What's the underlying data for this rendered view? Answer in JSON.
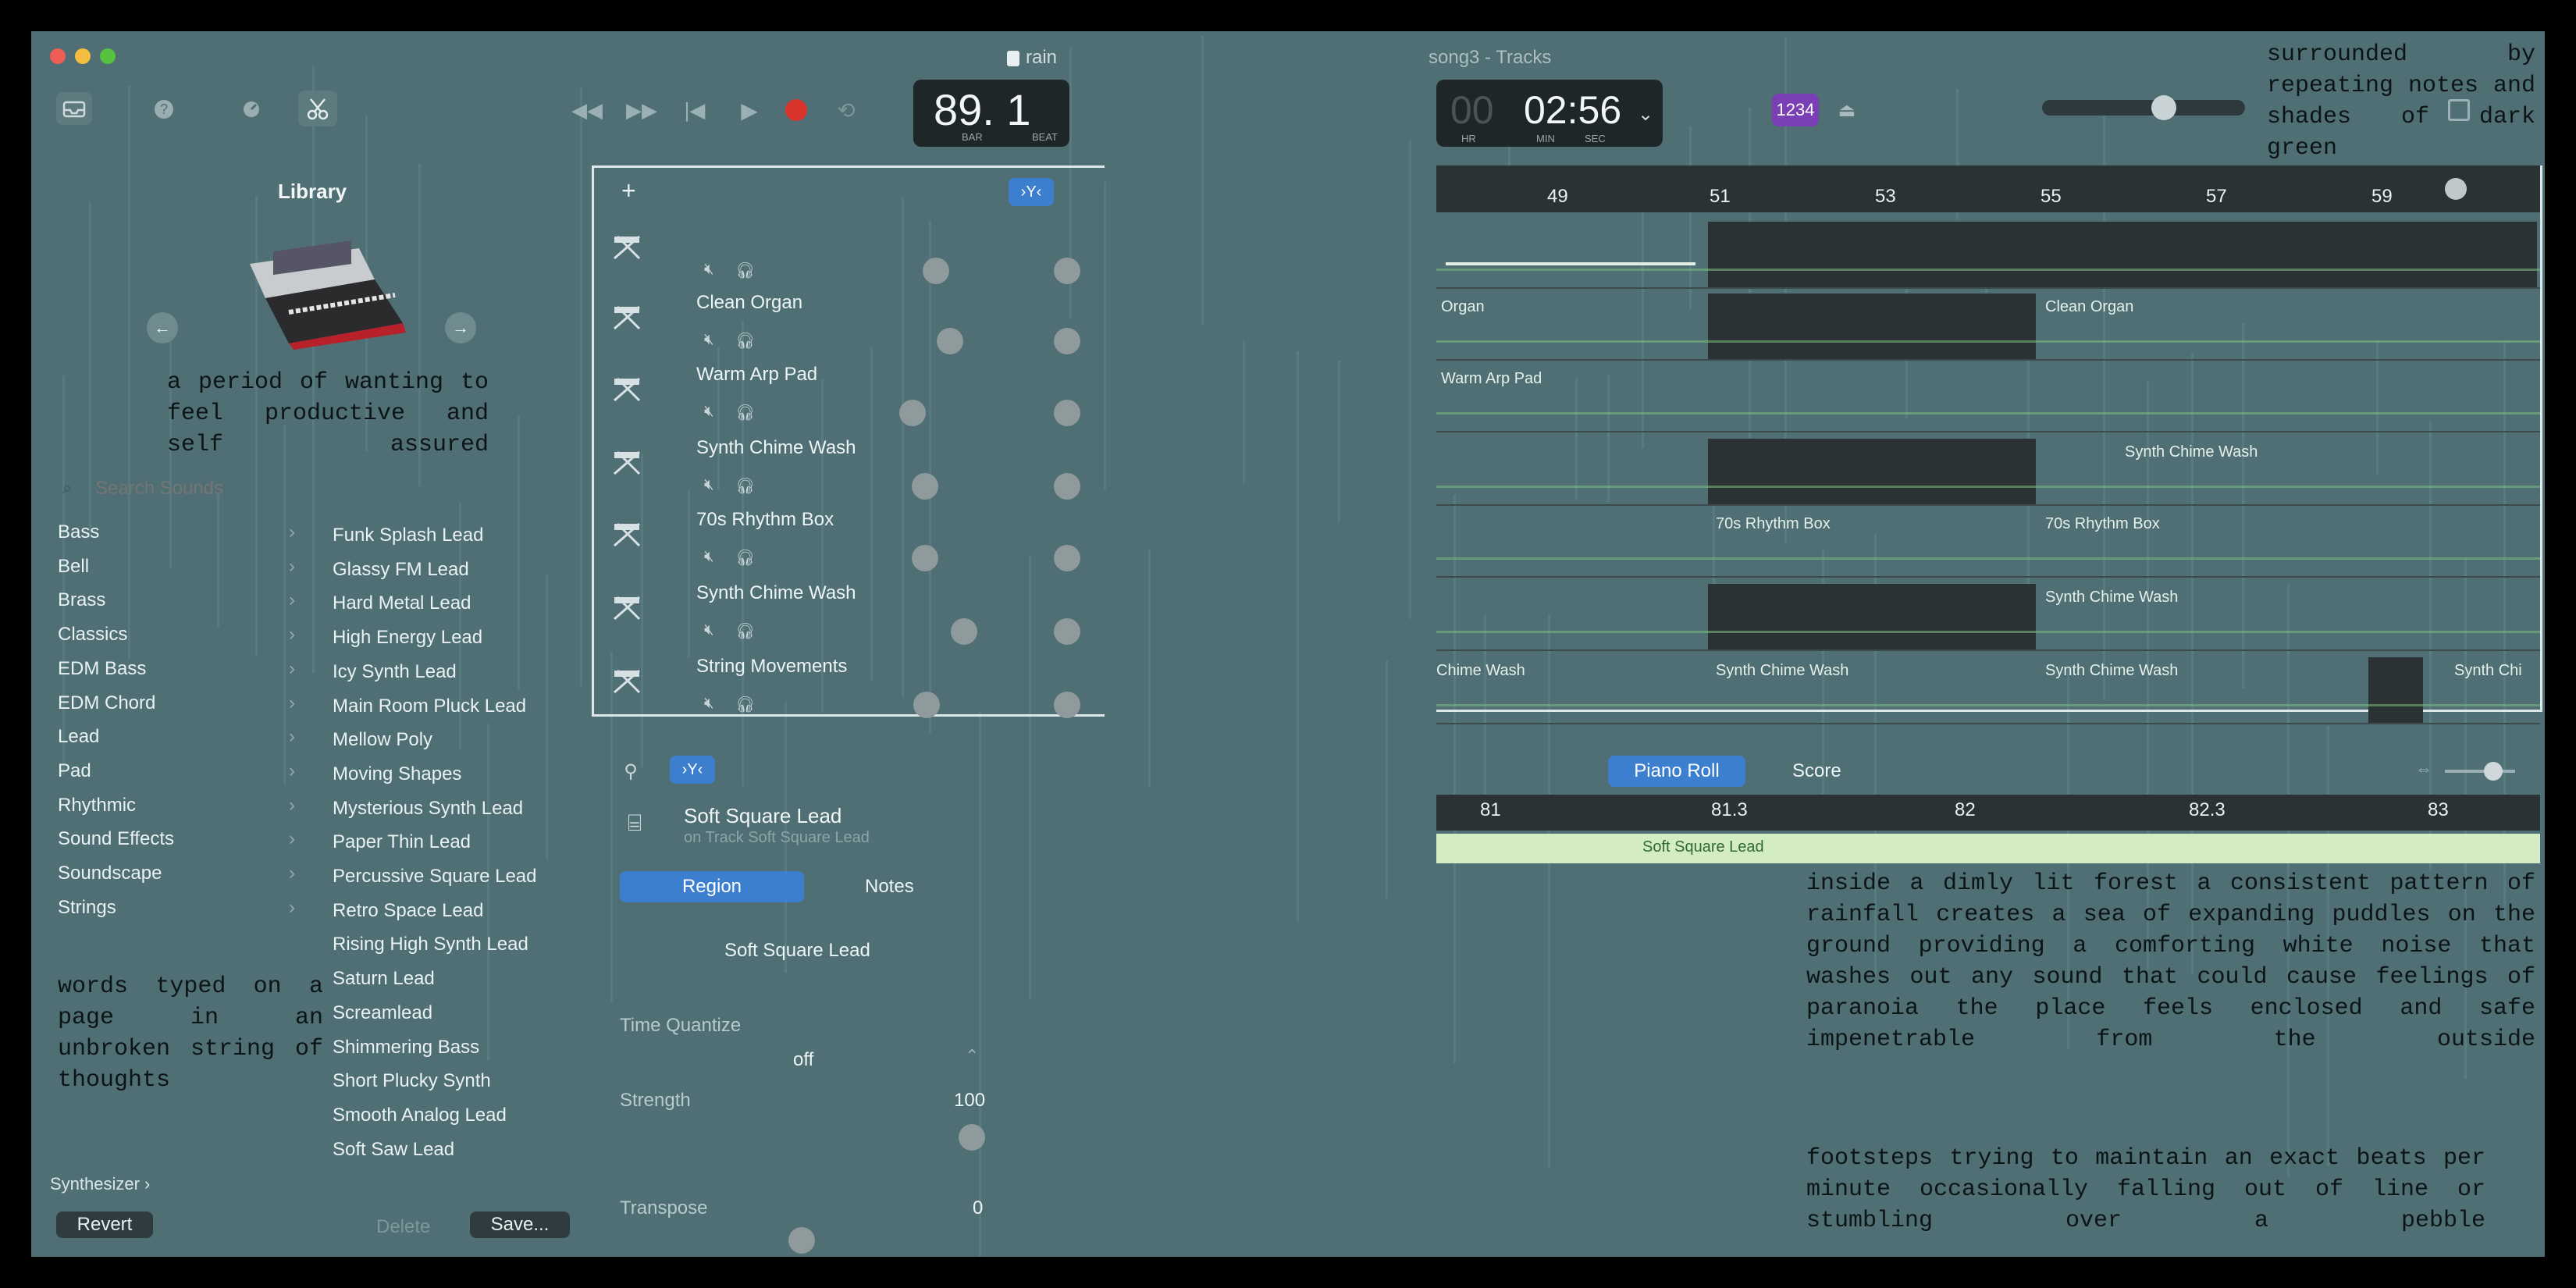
{
  "window": {
    "title_left": "rain",
    "title_right": "song3 - Tracks"
  },
  "lcd": {
    "bar_beat": "89. 1",
    "bar_label": "BAR",
    "beat_label": "BEAT",
    "time_zero": "00",
    "time_main": "02:56",
    "hr_label": "HR",
    "min_label": "MIN",
    "sec_label": "SEC"
  },
  "toolbar": {
    "count_in_label": "1234"
  },
  "library": {
    "title": "Library",
    "search_placeholder": "Search Sounds",
    "categories": [
      "Bass",
      "Bell",
      "Brass",
      "Classics",
      "EDM Bass",
      "EDM Chord",
      "Lead",
      "Pad",
      "Rhythmic",
      "Sound Effects",
      "Soundscape",
      "Strings"
    ],
    "patches": [
      "Funk Splash Lead",
      "Glassy FM Lead",
      "Hard Metal Lead",
      "High Energy Lead",
      "Icy Synth Lead",
      "Main Room Pluck Lead",
      "Mellow Poly",
      "Moving Shapes",
      "Mysterious Synth Lead",
      "Paper Thin Lead",
      "Percussive Square Lead",
      "Retro Space Lead",
      "Rising High Synth Lead",
      "Saturn Lead",
      "Screamlead",
      "Shimmering Bass",
      "Short Plucky Synth",
      "Smooth Analog Lead",
      "Soft Saw Lead"
    ],
    "footer_path": "Synthesizer ›",
    "revert_label": "Revert",
    "delete_label": "Delete",
    "save_label": "Save..."
  },
  "tracks": {
    "add_label": "+",
    "names": [
      "Clean Organ",
      "Warm Arp Pad",
      "Synth Chime Wash",
      "70s Rhythm Box",
      "Synth Chime Wash",
      "String Movements"
    ]
  },
  "ruler": {
    "bars": [
      "49",
      "51",
      "53",
      "55",
      "57",
      "59"
    ]
  },
  "regions": [
    {
      "label": "Organ"
    },
    {
      "label": "Clean Organ"
    },
    {
      "label": "Warm Arp Pad"
    },
    {
      "label": "Synth Chime Wash"
    },
    {
      "label": "70s Rhythm Box"
    },
    {
      "label": "70s Rhythm Box"
    },
    {
      "label": "Synth Chime Wash"
    },
    {
      "label": "Chime Wash"
    },
    {
      "label": "Synth Chime Wash"
    },
    {
      "label": "Synth Chime Wash"
    },
    {
      "label": "Synth Chi"
    }
  ],
  "editor": {
    "track_title": "Soft Square Lead",
    "track_subtitle": "on Track Soft Square Lead",
    "tab_region": "Region",
    "tab_notes": "Notes",
    "region_name": "Soft Square Lead",
    "time_quantize_label": "Time Quantize",
    "time_quantize_value": "off",
    "strength_label": "Strength",
    "strength_value": "100",
    "transpose_label": "Transpose",
    "transpose_value": "0",
    "piano_roll_label": "Piano Roll",
    "score_label": "Score",
    "ruler": [
      "81",
      "81.3",
      "82",
      "82.3",
      "83"
    ],
    "region_label": "Soft Square Lead"
  },
  "overlay_text": {
    "top_right": "surrounded by repeating notes and shades of dark green",
    "library_note": "a period of wanting to feel productive and self assured",
    "left_note": "words typed on a page in an unbroken string of thoughts",
    "forest": "inside a dimly lit forest a consistent pattern of rainfall creates a sea of expanding puddles on the ground providing a comforting white noise that washes out any sound that could cause feelings of paranoia the place feels enclosed and safe impenetrable from the outside",
    "footsteps": "footsteps trying to maintain an exact beats per minute occasionally falling out of line or stumbling over a pebble"
  },
  "colors": {
    "background": "#4f6f74",
    "bars": "#5e858b",
    "accent_blue": "#3d7fcf",
    "record_red": "#d9342b",
    "count_in_purple": "#7a3fb5",
    "region_green": "#7bbf7e"
  }
}
